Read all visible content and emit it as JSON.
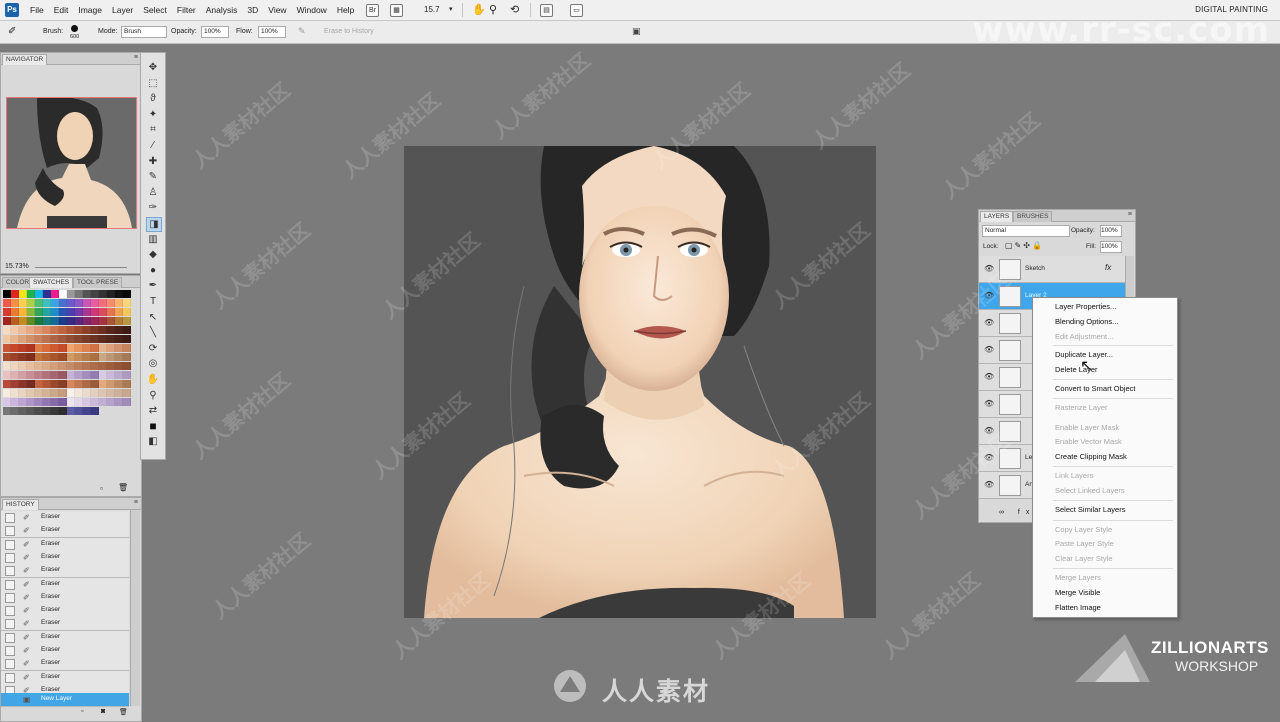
{
  "app": {
    "logo_text": "Ps",
    "workspace_label": "DIGITAL PAINTING",
    "watermark_url": "www.rr-sc.com"
  },
  "menubar": {
    "menus": [
      "File",
      "Edit",
      "Image",
      "Layer",
      "Select",
      "Filter",
      "Analysis",
      "3D",
      "View",
      "Window",
      "Help"
    ],
    "bridge_label": "Br",
    "zoom_value": "15.7"
  },
  "options_bar": {
    "brush_label": "Brush:",
    "brush_size": "600",
    "mode_label": "Mode:",
    "mode_value": "Brush",
    "opacity_label": "Opacity:",
    "opacity_value": "100%",
    "flow_label": "Flow:",
    "flow_value": "100%",
    "erase_history_label": "Erase to History"
  },
  "navigator": {
    "tab": "NAVIGATOR",
    "zoom_value": "15.73%"
  },
  "swatches_panel": {
    "tabs": [
      "COLOR",
      "SWATCHES",
      "TOOL PRESE"
    ]
  },
  "history": {
    "tab": "HISTORY",
    "items": [
      "Eraser",
      "Eraser",
      "Eraser",
      "Eraser",
      "Eraser",
      "Eraser",
      "Eraser",
      "Eraser",
      "Eraser",
      "Eraser",
      "Eraser",
      "Eraser",
      "Eraser",
      "Eraser"
    ],
    "current": "New Layer"
  },
  "layers": {
    "tabs": [
      "LAYERS",
      "BRUSHES"
    ],
    "blend_mode": "Normal",
    "opacity_label": "Opacity:",
    "opacity_value": "100%",
    "lock_label": "Lock:",
    "fill_label": "Fill:",
    "fill_value": "100%",
    "rows": [
      {
        "name": "Sketch",
        "fx": "fx"
      },
      {
        "name": "Layer 2"
      },
      {
        "name": ""
      },
      {
        "name": ""
      },
      {
        "name": ""
      },
      {
        "name": ""
      },
      {
        "name": ""
      },
      {
        "name": "Le"
      },
      {
        "name": "An"
      }
    ]
  },
  "context_menu": {
    "items": [
      {
        "label": "Layer Properties...",
        "enabled": true
      },
      {
        "label": "Blending Options...",
        "enabled": true
      },
      {
        "label": "Edit Adjustment...",
        "enabled": false
      },
      {
        "label": "Duplicate Layer...",
        "enabled": true
      },
      {
        "label": "Delete Layer",
        "enabled": true
      },
      {
        "label": "Convert to Smart Object",
        "enabled": true
      },
      {
        "label": "Rasterize Layer",
        "enabled": false
      },
      {
        "label": "Enable Layer Mask",
        "enabled": false
      },
      {
        "label": "Enable Vector Mask",
        "enabled": false
      },
      {
        "label": "Create Clipping Mask",
        "enabled": true
      },
      {
        "label": "Link Layers",
        "enabled": false
      },
      {
        "label": "Select Linked Layers",
        "enabled": false
      },
      {
        "label": "Select Similar Layers",
        "enabled": true
      },
      {
        "label": "Copy Layer Style",
        "enabled": false
      },
      {
        "label": "Paste Layer Style",
        "enabled": false
      },
      {
        "label": "Clear Layer Style",
        "enabled": false
      },
      {
        "label": "Merge Layers",
        "enabled": false
      },
      {
        "label": "Merge Visible",
        "enabled": true
      },
      {
        "label": "Flatten Image",
        "enabled": true
      }
    ]
  },
  "branding": {
    "zillion_line1": "ZILLIONARTS",
    "zillion_line2": "WORKSHOP",
    "rr_text": "人人素材",
    "wm_text": "人人素材社区"
  },
  "colors": {
    "selection_blue": "#3fa6eb",
    "canvas_bg": "#545454",
    "workspace_bg": "#7b7b7b"
  }
}
